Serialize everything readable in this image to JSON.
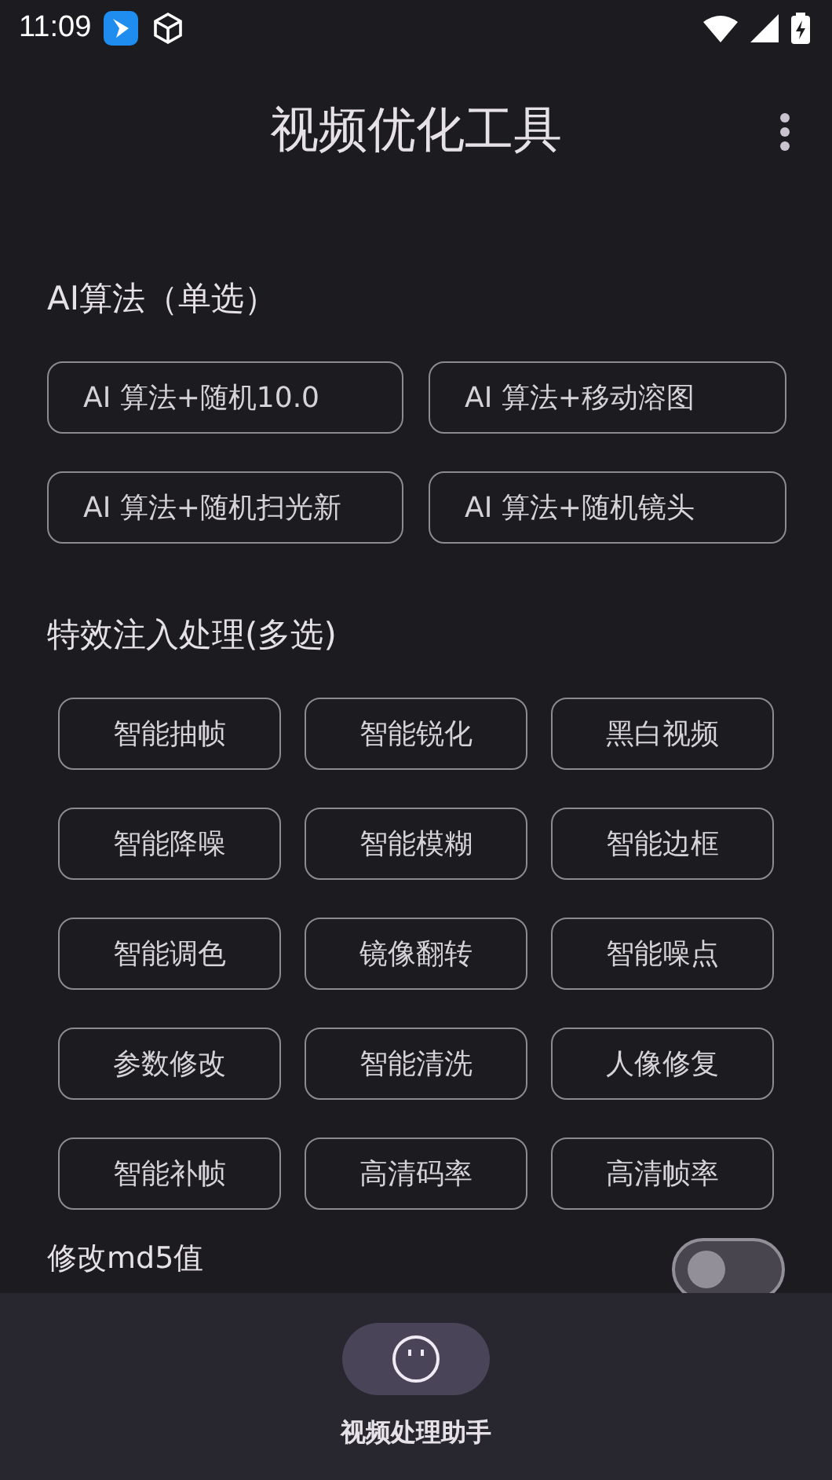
{
  "status_bar": {
    "time": "11:09"
  },
  "app_bar": {
    "title": "视频优化工具"
  },
  "ai_section": {
    "title": "AI算法（单选）",
    "options": [
      {
        "label": "AI 算法+随机10.0",
        "selected": false
      },
      {
        "label": "AI 算法+移动溶图",
        "selected": false
      },
      {
        "label": "AI 算法+随机扫光新",
        "selected": false
      },
      {
        "label": "AI 算法+随机镜头",
        "selected": false
      }
    ]
  },
  "effects_section": {
    "title": "特效注入处理(多选)",
    "options": [
      {
        "label": "智能抽帧",
        "selected": false
      },
      {
        "label": "智能锐化",
        "selected": false
      },
      {
        "label": "黑白视频",
        "selected": false
      },
      {
        "label": "智能降噪",
        "selected": false
      },
      {
        "label": "智能模糊",
        "selected": false
      },
      {
        "label": "智能边框",
        "selected": false
      },
      {
        "label": "智能调色",
        "selected": false
      },
      {
        "label": "镜像翻转",
        "selected": false
      },
      {
        "label": "智能噪点",
        "selected": false
      },
      {
        "label": "参数修改",
        "selected": false
      },
      {
        "label": "智能清洗",
        "selected": false
      },
      {
        "label": "人像修复",
        "selected": false
      },
      {
        "label": "智能补帧",
        "selected": false
      },
      {
        "label": "高清码率",
        "selected": false
      },
      {
        "label": "高清帧率",
        "selected": false
      }
    ]
  },
  "md5_setting": {
    "label": "修改md5值",
    "on": false
  },
  "bottom_nav": {
    "items": [
      {
        "label": "视频处理助手",
        "selected": true
      }
    ]
  }
}
